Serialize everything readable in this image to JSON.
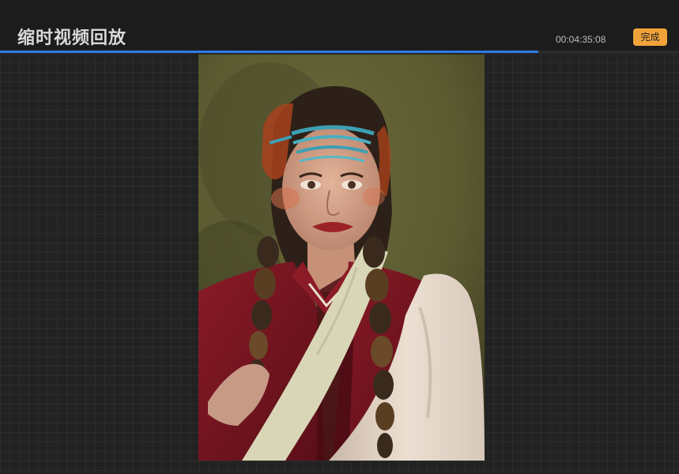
{
  "header": {
    "title": "缩时视频回放",
    "elapsed_time": "00:04:35:08",
    "done_label": "完成"
  },
  "playback": {
    "progress": 0.793
  },
  "artwork": {
    "subject": "portrait painting of a woman with braids and a beaded headband",
    "colors": {
      "background": "#5b5a30",
      "robe": "#7a1622",
      "sash": "#d8d6b6",
      "sleeve": "#e3d6c8",
      "headband": "#3d9fb2",
      "hair": "#2d2018",
      "skin": "#d6a48b"
    }
  }
}
